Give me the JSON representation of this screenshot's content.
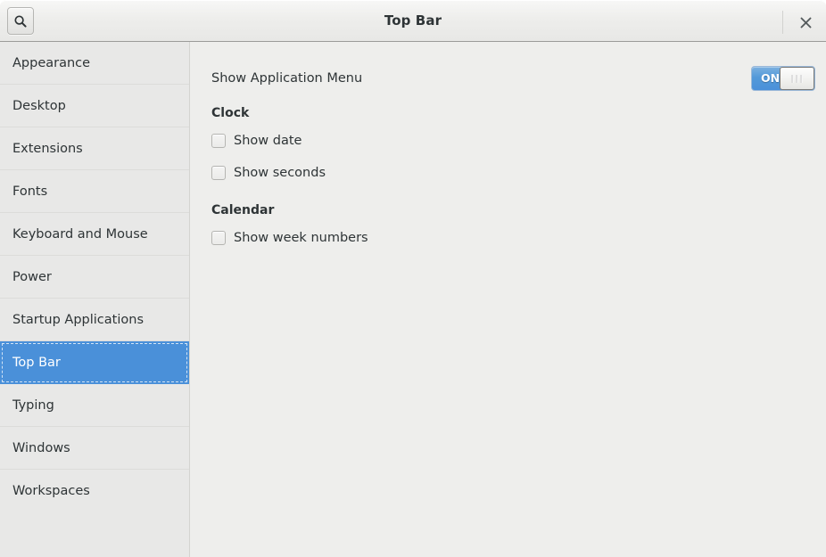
{
  "window": {
    "title": "Top Bar",
    "accent_color": "#4a90d9",
    "sidebar_bg": "#e8e8e7",
    "content_bg": "#eeeeec"
  },
  "header": {
    "title": "Top Bar",
    "search_icon": "search-icon",
    "close_icon": "close-icon"
  },
  "sidebar": {
    "items": [
      {
        "label": "Appearance",
        "selected": false
      },
      {
        "label": "Desktop",
        "selected": false
      },
      {
        "label": "Extensions",
        "selected": false
      },
      {
        "label": "Fonts",
        "selected": false
      },
      {
        "label": "Keyboard and Mouse",
        "selected": false
      },
      {
        "label": "Power",
        "selected": false
      },
      {
        "label": "Startup Applications",
        "selected": false
      },
      {
        "label": "Top Bar",
        "selected": true
      },
      {
        "label": "Typing",
        "selected": false
      },
      {
        "label": "Windows",
        "selected": false
      },
      {
        "label": "Workspaces",
        "selected": false
      }
    ]
  },
  "content": {
    "app_menu": {
      "label": "Show Application Menu",
      "switch_state": "ON",
      "switch_on": true
    },
    "clock": {
      "heading": "Clock",
      "options": [
        {
          "label": "Show date",
          "checked": false
        },
        {
          "label": "Show seconds",
          "checked": false
        }
      ]
    },
    "calendar": {
      "heading": "Calendar",
      "options": [
        {
          "label": "Show week numbers",
          "checked": false
        }
      ]
    }
  }
}
